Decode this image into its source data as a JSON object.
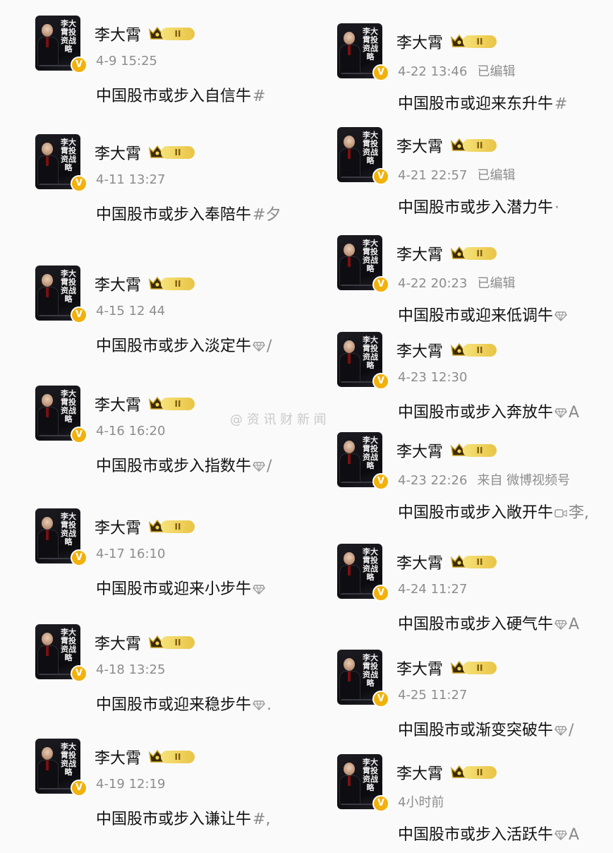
{
  "user": {
    "name": "李大霄",
    "level_badge": "II",
    "verified_mark": "V",
    "avatar_book_title": "李大霄投资战略"
  },
  "icons": {
    "avatar": "book-cover-avatar",
    "verified": "verified-v-badge",
    "member": "crown-member-icon",
    "diamond": "diamond-gem-icon",
    "video": "video-icon"
  },
  "colors": {
    "verified_badge": "#f2b10b",
    "member_pill": "#e9c446",
    "meta_text": "#8d8d8d"
  },
  "watermark": "@ 资 讯 财 新 闻",
  "left_posts": [
    {
      "time": "4-9 15:25",
      "edited": "",
      "text": "中国股市或步入自信牛",
      "tail": "#"
    },
    {
      "time": "4-11 13:27",
      "edited": "",
      "text": "中国股市或步入奉陪牛",
      "tail": "#夕"
    },
    {
      "time": "4-15 12 44",
      "edited": "",
      "text": "中国股市或步入淡定牛",
      "tail": "/"
    },
    {
      "time": "4-16 16:20",
      "edited": "",
      "text": "中国股市或步入指数牛",
      "tail": "/"
    },
    {
      "time": "4-17 16:10",
      "edited": "",
      "text": "中国股市或迎来小步牛",
      "tail": ""
    },
    {
      "time": "4-18 13:25",
      "edited": "",
      "text": "中国股市或迎来稳步牛",
      "tail": "."
    },
    {
      "time": "4-19 12:19",
      "edited": "",
      "text": "中国股市或步入谦让牛",
      "tail": "#,"
    }
  ],
  "right_posts": [
    {
      "time": "4-22 13:46",
      "edited": "已编辑",
      "text": "中国股市或迎来东升牛",
      "tail": "#"
    },
    {
      "time": "4-21 22:57",
      "edited": "已编辑",
      "text": "中国股市或步入潜力牛",
      "tail": "·"
    },
    {
      "time": "4-22 20:23",
      "edited": "已编辑",
      "text": "中国股市或迎来低调牛",
      "tail": ""
    },
    {
      "time": "4-23 12:30",
      "edited": "",
      "text": "中国股市或步入奔放牛",
      "tail": "A"
    },
    {
      "time": "4-23 22:26",
      "edited": "来自 微博视频号",
      "text": "中国股市或步入敞开牛",
      "tail": "李,"
    },
    {
      "time": "4-24 11:27",
      "edited": "",
      "text": "中国股市或步入硬气牛",
      "tail": "A"
    },
    {
      "time": "4-25 11:27",
      "edited": "",
      "text": "中国股市或渐变突破牛",
      "tail": "/"
    },
    {
      "time": "4小时前",
      "edited": "",
      "text": "中国股市或步入活跃牛",
      "tail": "A"
    }
  ]
}
